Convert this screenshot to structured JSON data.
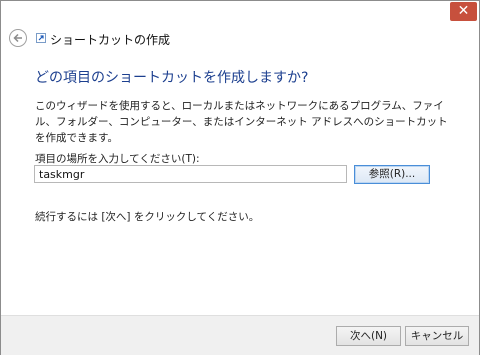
{
  "window": {
    "close_glyph": "✕"
  },
  "header": {
    "title": "ショートカットの作成"
  },
  "main": {
    "heading": "どの項目のショートカットを作成しますか?",
    "description": "このウィザードを使用すると、ローカルまたはネットワークにあるプログラム、ファイル、フォルダー、コンピューター、またはインターネット アドレスへのショートカットを作成できます。",
    "field_label": "項目の場所を入力してください(T):",
    "field_value": "taskmgr",
    "browse_label": "参照(R)...",
    "hint": "続行するには [次へ] をクリックしてください。"
  },
  "footer": {
    "next_label": "次へ(N)",
    "cancel_label": "キャンセル"
  },
  "colors": {
    "heading": "#1c3f8f",
    "close_button": "#c7503d",
    "focus_border": "#4a8ed8"
  }
}
